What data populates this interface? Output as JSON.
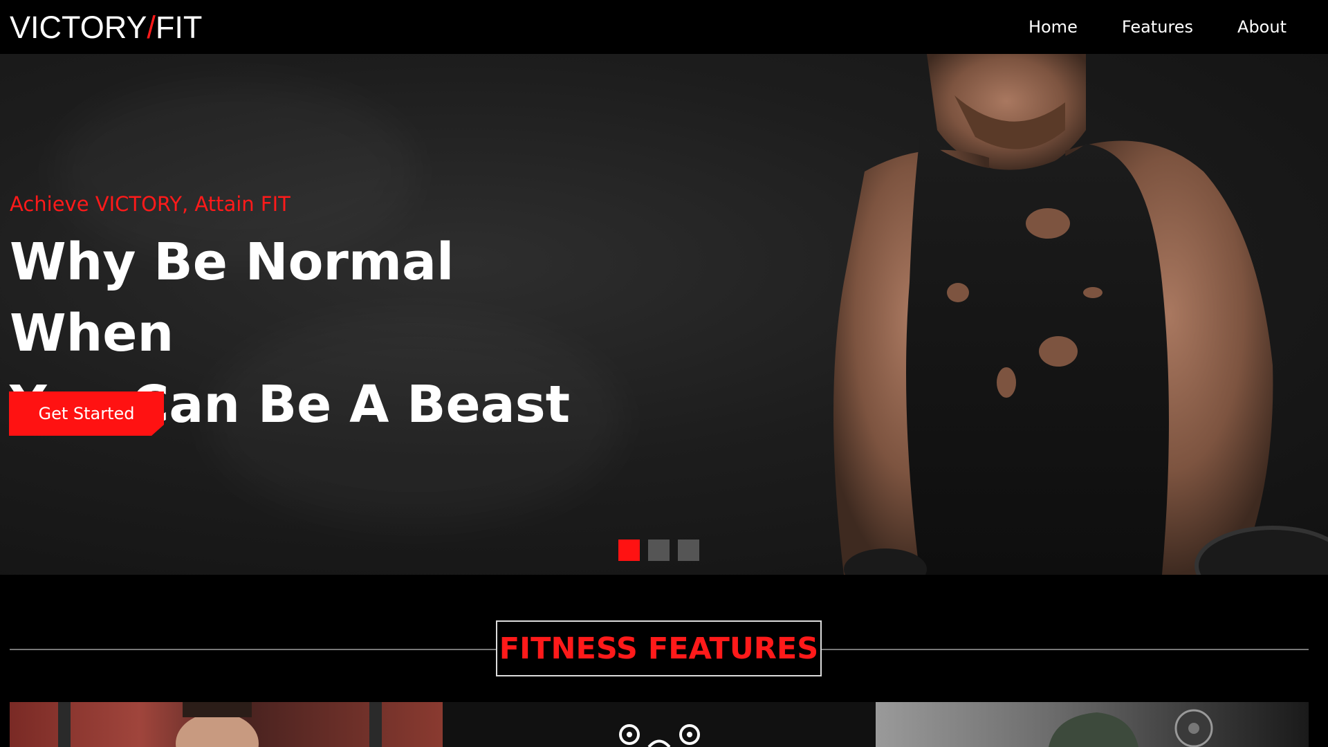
{
  "brand": {
    "part1": "VICTORY",
    "slash": "/",
    "part2": "FIT"
  },
  "nav": {
    "items": [
      "Home",
      "Features",
      "About"
    ]
  },
  "hero": {
    "tagline": "Achieve VICTORY, Attain FIT",
    "headline_line1": "Why Be Normal When",
    "headline_line2": "You Can Be A Beast",
    "cta_label": "Get Started",
    "slides": {
      "count": 3,
      "active": 1
    }
  },
  "features": {
    "heading": "FITNESS FEATURES"
  },
  "colors": {
    "accent": "#ff1212",
    "background": "#000000",
    "text": "#ffffff"
  },
  "icons": [
    "medal-icon"
  ]
}
